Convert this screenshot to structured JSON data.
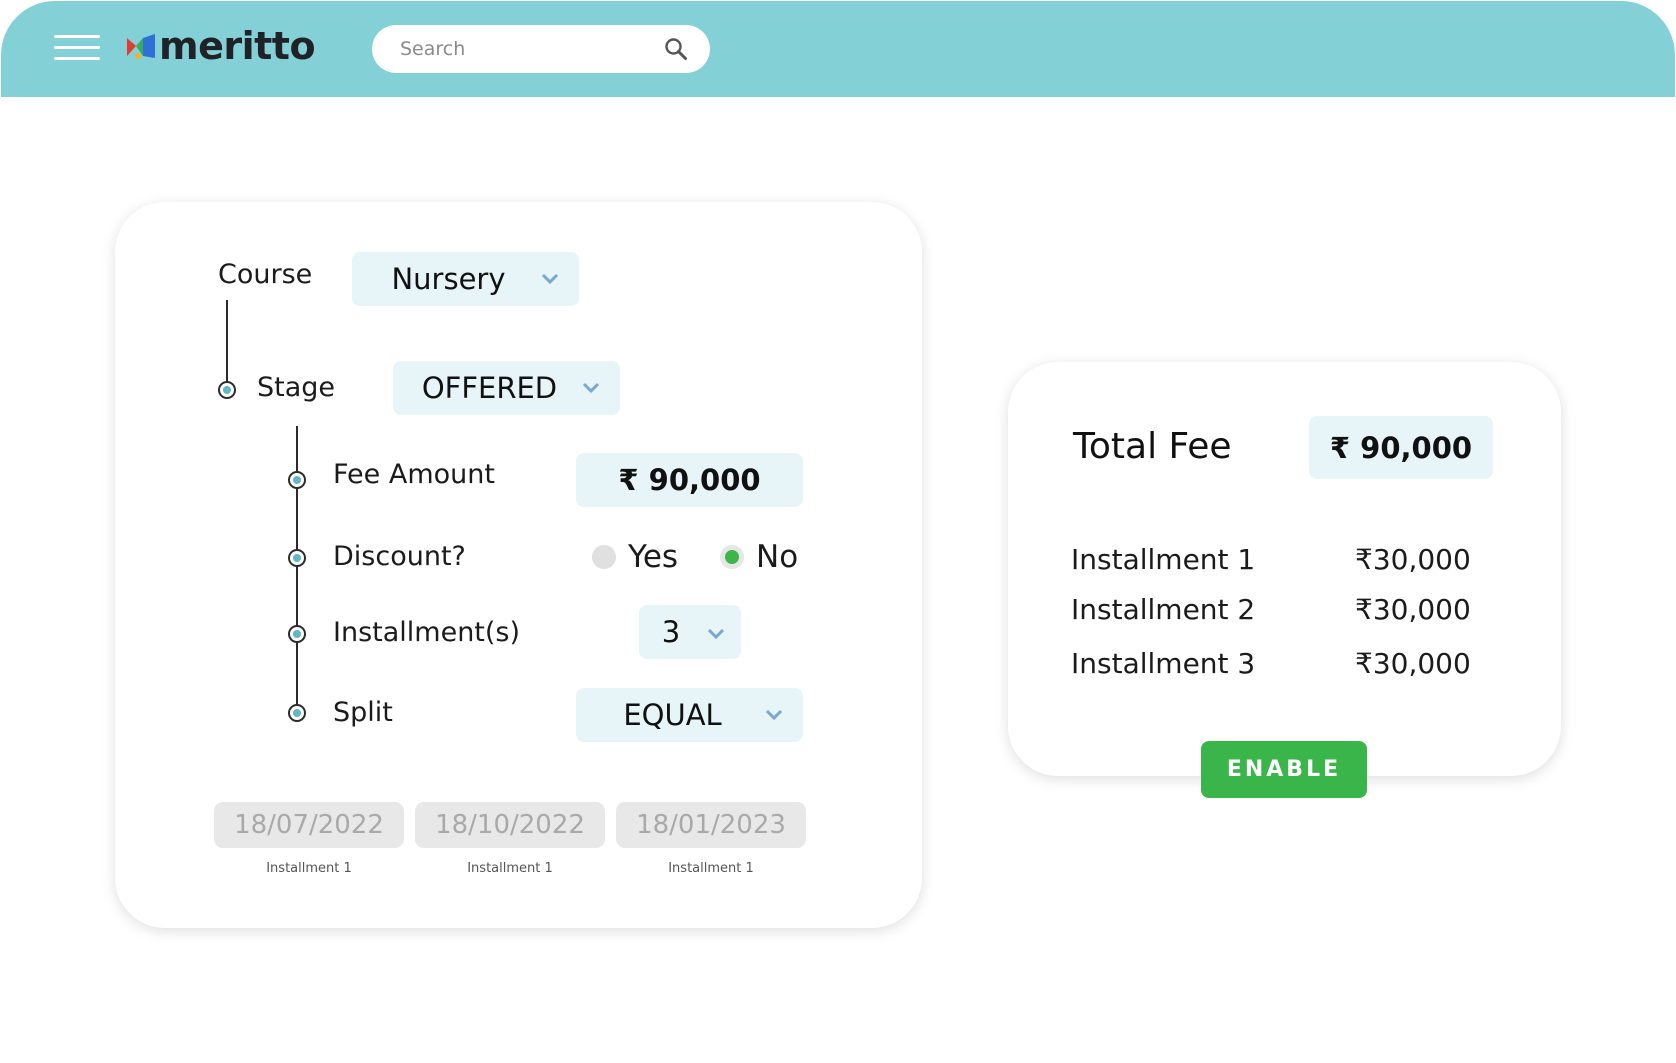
{
  "header": {
    "logo_text": "meritto",
    "search_placeholder": "Search"
  },
  "form": {
    "course_label": "Course",
    "course_value": "Nursery",
    "stage_label": "Stage",
    "stage_value": "OFFERED",
    "fee_amount_label": "Fee Amount",
    "fee_amount_value": "₹ 90,000",
    "discount_label": "Discount?",
    "discount_options": [
      {
        "label": "Yes",
        "selected": false
      },
      {
        "label": "No",
        "selected": true
      }
    ],
    "installments_label": "Installment(s)",
    "installments_value": "3",
    "split_label": "Split",
    "split_value": "EQUAL",
    "dates": [
      {
        "date": "18/07/2022",
        "caption": "Installment 1"
      },
      {
        "date": "18/10/2022",
        "caption": "Installment 1"
      },
      {
        "date": "18/01/2023",
        "caption": "Installment 1"
      }
    ]
  },
  "summary": {
    "total_label": "Total Fee",
    "total_value": "₹ 90,000",
    "installments": [
      {
        "label": "Installment 1",
        "amount": "₹30,000"
      },
      {
        "label": "Installment 2",
        "amount": "₹30,000"
      },
      {
        "label": "Installment 3",
        "amount": "₹30,000"
      }
    ],
    "enable_label": "ENABLE"
  },
  "colors": {
    "header_bg": "#83d1d6",
    "field_bg": "#e7f5f8",
    "accent_green": "#3ab54a",
    "chevron": "#7aa7cf"
  }
}
